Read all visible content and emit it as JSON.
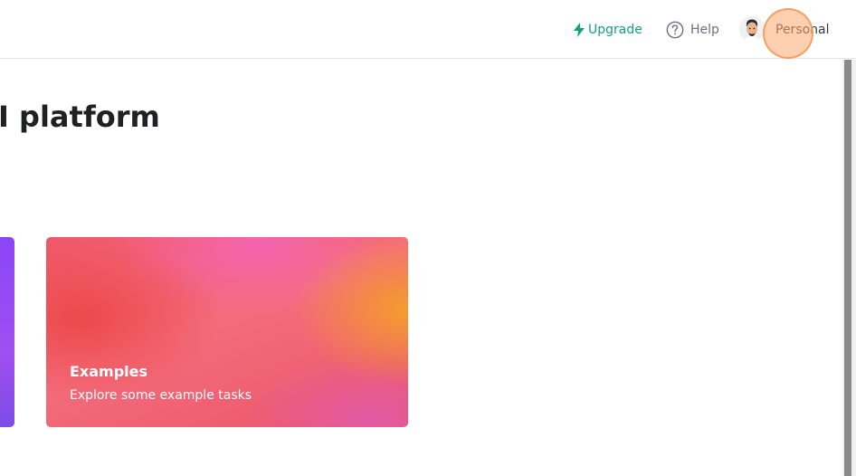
{
  "header": {
    "upgrade_label": "Upgrade",
    "help_label": "Help",
    "account_label": "Personal",
    "upgrade_icon": "bolt-icon",
    "help_icon": "question-circle-icon",
    "accent_color": "#10a37f"
  },
  "main": {
    "title": "I platform",
    "cards": [
      {
        "title": "Examples",
        "description": "Explore some example tasks"
      }
    ]
  }
}
